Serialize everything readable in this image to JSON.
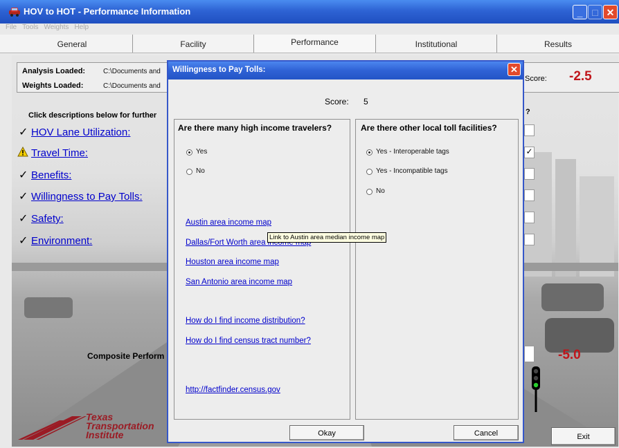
{
  "window": {
    "title": "HOV to HOT - Performance Information",
    "menu": [
      "File",
      "Tools",
      "Weights",
      "Help"
    ],
    "tabs": [
      "General",
      "Facility",
      "Performance",
      "Institutional",
      "Results"
    ],
    "active_tab": "Performance"
  },
  "info": {
    "analysis_label": "Analysis Loaded:",
    "analysis_path": "C:\\Documents and",
    "weights_label": "Weights Loaded:",
    "weights_path": "C:\\Documents and",
    "score_label": "Score:",
    "score_value": "-2.5"
  },
  "instructions": "Click descriptions below for further",
  "question_mark": "?",
  "criteria": [
    {
      "label": "HOV Lane Utilization:",
      "status": "check",
      "checked": false
    },
    {
      "label": "Travel Time:",
      "status": "warning",
      "checked": true
    },
    {
      "label": "Benefits:",
      "status": "check",
      "checked": false
    },
    {
      "label": "Willingness to Pay Tolls:",
      "status": "check",
      "checked": false
    },
    {
      "label": "Safety:",
      "status": "check",
      "checked": false
    },
    {
      "label": "Environment:",
      "status": "check",
      "checked": false
    }
  ],
  "composite": {
    "label": "Composite Perform",
    "value": "-5.0"
  },
  "logo": {
    "line1": "Texas",
    "line2": "Transportation",
    "line3": "Institute"
  },
  "exit_label": "Exit",
  "dialog": {
    "title": "Willingness to Pay Tolls:",
    "score_label": "Score:",
    "score_value": "5",
    "left_question": "Are there many high income travelers?",
    "left_options": [
      {
        "label": "Yes",
        "selected": true
      },
      {
        "label": "No",
        "selected": false
      }
    ],
    "links": [
      "Austin area income map",
      "Dallas/Fort Worth area income map",
      "Houston area income map",
      "San Antonio area income map",
      "How do I find income distribution?",
      "How do I find census tract number?",
      "http://factfinder.census.gov"
    ],
    "right_question": "Are there other local toll facilities?",
    "right_options": [
      {
        "label": "Yes - Interoperable tags",
        "selected": true
      },
      {
        "label": "Yes - Incompatible tags",
        "selected": false
      },
      {
        "label": "No",
        "selected": false
      }
    ],
    "okay_label": "Okay",
    "cancel_label": "Cancel",
    "tooltip": "Link to Austin area median income map"
  },
  "colors": {
    "title_blue": "#2e63d4",
    "score_red": "#c0151b",
    "link_blue": "#0000cc"
  }
}
